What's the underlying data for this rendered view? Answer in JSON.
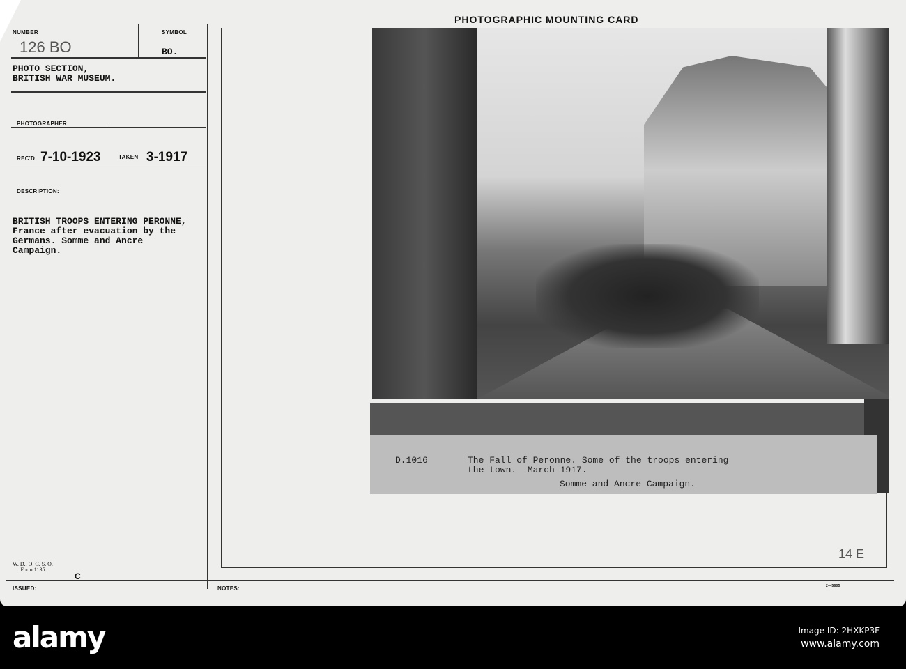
{
  "card": {
    "title": "PHOTOGRAPHIC MOUNTING CARD",
    "number_label": "NUMBER",
    "number_value": "126 BO",
    "symbol_label": "SYMBOL",
    "symbol_value": "BO.",
    "source": "PHOTO SECTION,\nBRITISH WAR MUSEUM.",
    "photographer_label": "PHOTOGRAPHER",
    "recd_label": "REC'D",
    "recd_value": "7-10-1923",
    "taken_label": "TAKEN",
    "taken_value": "3-1917",
    "description_label": "DESCRIPTION:",
    "description": "BRITISH TROOPS ENTERING PERONNE,\nFrance after evacuation by the\nGermans. Somme and Ancre\nCampaign.",
    "form": "W. D., O. C. S. O.\nForm 1135",
    "form_mark": "C",
    "issued_label": "ISSUED:",
    "notes_label": "NOTES:",
    "corner_note": "14 E",
    "print_code": "2—5605"
  },
  "photo": {
    "caption_id": "D.1016",
    "caption": "The Fall of Peronne. Some of the troops entering\nthe town.  March 1917.",
    "caption_campaign": "Somme and Ancre Campaign."
  },
  "watermark": {
    "brand": "alamy",
    "image_id": "Image ID: 2HXKP3F",
    "url": "www.alamy.com"
  }
}
